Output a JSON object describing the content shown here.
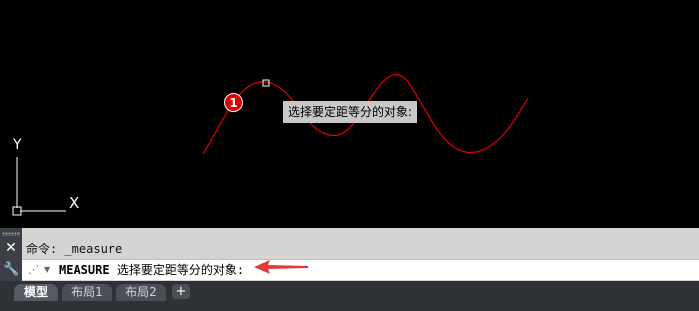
{
  "canvas": {
    "tooltip_text": "选择要定距等分的对象:",
    "step_marker": "1",
    "ucs_axis_labels": {
      "x": "X",
      "y": "Y"
    },
    "curve_color": "#e00000",
    "background_color": "#000000"
  },
  "command_panel": {
    "history_line": "命令: _measure",
    "input_command": "MEASURE",
    "input_prompt": "选择要定距等分的对象:",
    "icons": [
      "close-icon",
      "wrench-icon",
      "command-icon",
      "dropdown-icon"
    ]
  },
  "tabs": [
    {
      "label": "模型",
      "active": true
    },
    {
      "label": "布局1",
      "active": false
    },
    {
      "label": "布局2",
      "active": false
    }
  ],
  "add_tab_label": "+",
  "annotation_arrow_color": "#e23a3a"
}
